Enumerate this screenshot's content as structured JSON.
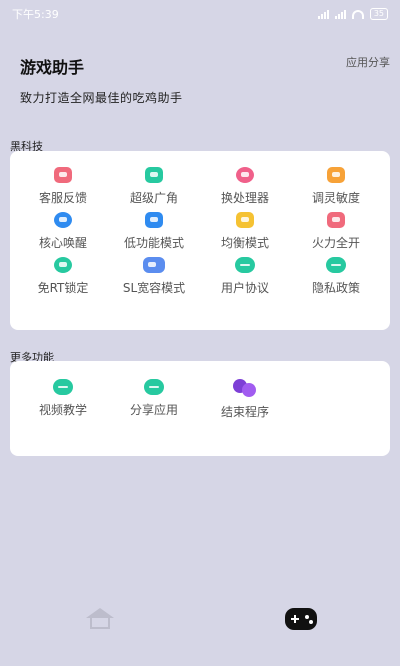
{
  "status_bar": {
    "time": "下午5:39",
    "battery": "35"
  },
  "header": {
    "title": "游戏助手",
    "share": "应用分享",
    "slogan": "致力打造全网最佳的吃鸡助手"
  },
  "sections": [
    {
      "title": "黑科技",
      "items": [
        {
          "label": "客服反馈",
          "icon": "feedback-icon",
          "color": "#f06a7c"
        },
        {
          "label": "超级广角",
          "icon": "wide-angle-icon",
          "color": "#27c9a0"
        },
        {
          "label": "换处理器",
          "icon": "processor-icon",
          "color": "#f0608a"
        },
        {
          "label": "调灵敏度",
          "icon": "sensitivity-icon",
          "color": "#f7a238"
        },
        {
          "label": "核心唤醒",
          "icon": "core-wake-icon",
          "color": "#2f8bf0"
        },
        {
          "label": "低功能模式",
          "icon": "low-power-icon",
          "color": "#2f8bf0"
        },
        {
          "label": "均衡模式",
          "icon": "balance-icon",
          "color": "#f5c233"
        },
        {
          "label": "火力全开",
          "icon": "full-power-icon",
          "color": "#f06a7c"
        },
        {
          "label": "免RT锁定",
          "icon": "fish-icon",
          "color": "#27c9a0"
        },
        {
          "label": "SL宽容模式",
          "icon": "gamepad-icon",
          "color": "#5b8def"
        },
        {
          "label": "用户协议",
          "icon": "chat-icon",
          "color": "#27c9a0"
        },
        {
          "label": "隐私政策",
          "icon": "chat-icon",
          "color": "#27c9a0"
        }
      ]
    },
    {
      "title": "更多功能",
      "items": [
        {
          "label": "视频教学",
          "icon": "chat-icon",
          "color": "#27c9a0"
        },
        {
          "label": "分享应用",
          "icon": "chat-icon",
          "color": "#27c9a0"
        },
        {
          "label": "结束程序",
          "icon": "bubbles-icon",
          "color": "#7d3fd6"
        }
      ]
    }
  ],
  "bottom_nav": [
    {
      "name": "home",
      "icon": "home-icon",
      "active": false
    },
    {
      "name": "game",
      "icon": "gamepad-icon",
      "active": true
    }
  ]
}
